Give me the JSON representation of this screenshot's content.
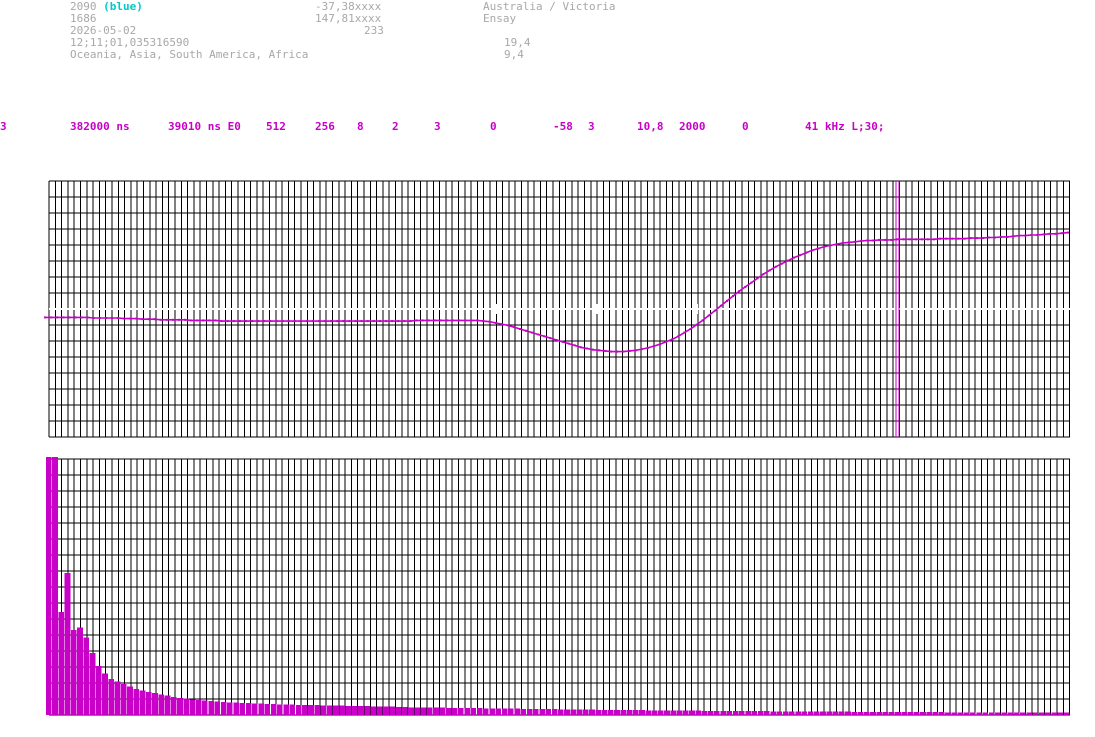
{
  "header": {
    "station_id": "2090",
    "station_color": "(blue)",
    "line2": "1686",
    "date": "2026-05-02",
    "time": "12;11;01,035316590",
    "regions": "Oceania, Asia, South America, Africa",
    "lat": "-37,38xxxx",
    "lon": "147,81xxxx",
    "alt": "233",
    "location": "Australia / Victoria",
    "place": "Ensay",
    "val1": "19,4",
    "val2": "9,4"
  },
  "params": [
    "3",
    "382000 ns",
    "39010 ns E0",
    "512",
    "256",
    "8",
    "2",
    "3",
    "0",
    "-58",
    "3",
    "10,8",
    "2000",
    "0",
    "41 kHz L;30;"
  ],
  "colors": {
    "grid": "#000000",
    "trace": "#c800c8",
    "bars": "#c800c8",
    "meta": "#a8a8a8",
    "accent": "#00c8c8"
  },
  "chart_data": [
    {
      "type": "line",
      "series": [
        {
          "values": [
            0.01,
            0.01,
            0.01,
            0.01,
            0.01,
            0.01,
            0.01,
            0.01,
            0.0,
            0.0,
            0.0,
            0.0,
            0.0,
            -0.01,
            -0.01,
            -0.01,
            -0.02,
            -0.02,
            -0.02,
            -0.03,
            -0.03,
            -0.03,
            -0.03,
            -0.03,
            -0.04,
            -0.04,
            -0.04,
            -0.04,
            -0.04,
            -0.05,
            -0.05,
            -0.05,
            -0.05,
            -0.05,
            -0.05,
            -0.05,
            -0.05,
            -0.05,
            -0.05,
            -0.05,
            -0.05,
            -0.05,
            -0.05,
            -0.05,
            -0.05,
            -0.05,
            -0.05,
            -0.05,
            -0.05,
            -0.05,
            -0.05,
            -0.05,
            -0.05,
            -0.05,
            -0.05,
            -0.05,
            -0.05,
            -0.05,
            -0.05,
            -0.05,
            -0.05,
            -0.04,
            -0.04,
            -0.04,
            -0.04,
            -0.04,
            -0.04,
            -0.04,
            -0.04,
            -0.04,
            -0.04,
            -0.04,
            -0.05,
            -0.06,
            -0.08,
            -0.1,
            -0.12,
            -0.15,
            -0.18,
            -0.21,
            -0.24,
            -0.27,
            -0.3,
            -0.33,
            -0.36,
            -0.39,
            -0.42,
            -0.45,
            -0.48,
            -0.5,
            -0.52,
            -0.53,
            -0.54,
            -0.55,
            -0.55,
            -0.55,
            -0.54,
            -0.53,
            -0.51,
            -0.49,
            -0.46,
            -0.43,
            -0.39,
            -0.35,
            -0.3,
            -0.24,
            -0.18,
            -0.11,
            -0.04,
            0.04,
            0.12,
            0.2,
            0.28,
            0.36,
            0.44,
            0.51,
            0.58,
            0.65,
            0.72,
            0.78,
            0.84,
            0.89,
            0.94,
            0.99,
            1.03,
            1.07,
            1.11,
            1.14,
            1.17,
            1.19,
            1.21,
            1.23,
            1.24,
            1.25,
            1.26,
            1.27,
            1.27,
            1.28,
            1.28,
            1.28,
            1.29,
            1.29,
            1.29,
            1.29,
            1.29,
            1.29,
            1.29,
            1.3,
            1.3,
            1.3,
            1.3,
            1.3,
            1.31,
            1.31,
            1.31,
            1.32,
            1.32,
            1.33,
            1.33,
            1.34,
            1.35,
            1.35,
            1.36,
            1.36,
            1.37,
            1.38,
            1.38,
            1.39,
            1.4
          ]
        }
      ],
      "ylim": [
        -2,
        2
      ],
      "grid": true,
      "marker_column": 140
    },
    {
      "type": "bar",
      "values": [
        1.0,
        1.0,
        0.4,
        0.55,
        0.33,
        0.34,
        0.3,
        0.24,
        0.19,
        0.16,
        0.14,
        0.13,
        0.12,
        0.11,
        0.1,
        0.095,
        0.09,
        0.085,
        0.08,
        0.075,
        0.07,
        0.066,
        0.063,
        0.06,
        0.058,
        0.056,
        0.054,
        0.052,
        0.05,
        0.049,
        0.048,
        0.047,
        0.046,
        0.045,
        0.044,
        0.043,
        0.042,
        0.041,
        0.04,
        0.04,
        0.039,
        0.039,
        0.038,
        0.038,
        0.037,
        0.037,
        0.036,
        0.036,
        0.035,
        0.035,
        0.034,
        0.034,
        0.033,
        0.033,
        0.032,
        0.032,
        0.031,
        0.031,
        0.03,
        0.03,
        0.03,
        0.029,
        0.029,
        0.029,
        0.028,
        0.028,
        0.028,
        0.027,
        0.027,
        0.027,
        0.026,
        0.026,
        0.026,
        0.025,
        0.025,
        0.025,
        0.024,
        0.024,
        0.024,
        0.023,
        0.023,
        0.023,
        0.022,
        0.022,
        0.022,
        0.021,
        0.021,
        0.021,
        0.02,
        0.02,
        0.02,
        0.02,
        0.019,
        0.019,
        0.019,
        0.019,
        0.018,
        0.018,
        0.018,
        0.018,
        0.017,
        0.017,
        0.017,
        0.017,
        0.017,
        0.016,
        0.016,
        0.016,
        0.016,
        0.016,
        0.015,
        0.015,
        0.015,
        0.015,
        0.015,
        0.015,
        0.014,
        0.014,
        0.014,
        0.014,
        0.014,
        0.014,
        0.013,
        0.013,
        0.013,
        0.013,
        0.013,
        0.013,
        0.013,
        0.012,
        0.012,
        0.012,
        0.012,
        0.012,
        0.012,
        0.012,
        0.011,
        0.011,
        0.011,
        0.011,
        0.011,
        0.011,
        0.011,
        0.011,
        0.01,
        0.01,
        0.01,
        0.01,
        0.01,
        0.01,
        0.01,
        0.01,
        0.01,
        0.01,
        0.01,
        0.01,
        0.01,
        0.01,
        0.01,
        0.01,
        0.01,
        0.01,
        0.01,
        0.01
      ],
      "ylim": [
        0,
        1
      ],
      "grid": true
    }
  ]
}
